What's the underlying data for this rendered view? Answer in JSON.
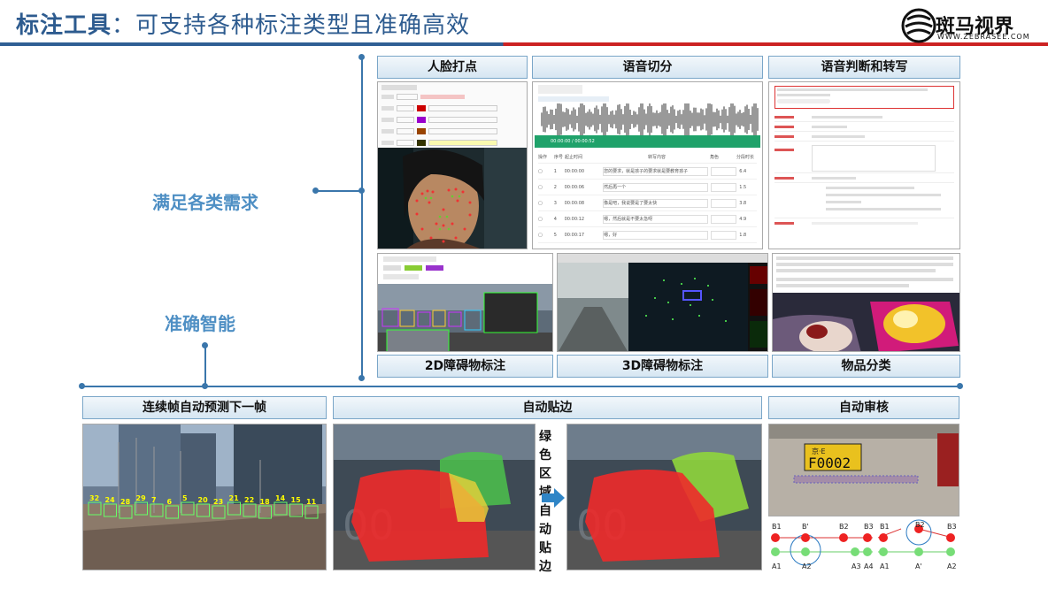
{
  "header": {
    "title_main": "标注工具",
    "title_rest": "：可支持各种标注类型且准确高效"
  },
  "logo": {
    "name": "斑马视界",
    "url_text": "WWW.ZEBRASEE.COM"
  },
  "side_labels": {
    "needs": "满足各类需求",
    "smart": "准确智能"
  },
  "top_panels": {
    "face": "人脸打点",
    "speech_split": "语音切分",
    "speech_judge": "语音判断和转写",
    "obstacle_2d": "2D障碍物标注",
    "obstacle_3d": "3D障碍物标注",
    "item_class": "物品分类"
  },
  "bottom_panels": {
    "predict": "连续帧自动预测下一帧",
    "snap": "自动贴边",
    "review": "自动审核"
  },
  "snap_note": "绿色区域自动贴边",
  "speech_table": {
    "headers": [
      "操作",
      "序号",
      "起止时间",
      "转写内容",
      "角色",
      "分段时长"
    ],
    "rows": [
      {
        "idx": "1",
        "time": "00:00:00\n00:00:06",
        "text": "您的要求，就是孩子的要求就是要教育孩子",
        "dur": "6.4"
      },
      {
        "idx": "2",
        "time": "00:00:06\n00:00:08",
        "text": "然后再一个",
        "dur": "1.5"
      },
      {
        "idx": "3",
        "time": "00:00:08\n00:00:12",
        "text": "像是吧，我说要是了要太快",
        "dur": "3.8"
      },
      {
        "idx": "4",
        "time": "00:00:12\n00:00:17",
        "text": "嗯，然后就是不要太急呀",
        "dur": "4.9"
      },
      {
        "idx": "5",
        "time": "00:00:17\n00:00:18",
        "text": "嗯，好",
        "dur": "1.8"
      }
    ],
    "player_time": "00:00:00 / 00:00:52"
  },
  "review": {
    "plate": "F0002",
    "plate_prefix": "京·E",
    "labels_top": [
      "B1",
      "B'",
      "B2",
      "B3",
      "B1",
      "B2",
      "B3"
    ],
    "labels_bottom": [
      "A1",
      "A2",
      "A3",
      "A4",
      "A1",
      "A'",
      "A2"
    ]
  },
  "predict_ids": [
    "32",
    "24",
    "28",
    "29",
    "7",
    "6",
    "5",
    "20",
    "23",
    "21",
    "22",
    "18",
    "14",
    "15",
    "11"
  ],
  "colors": {
    "title": "#2d5b8f",
    "side_label": "#4e8fc4",
    "accent_red": "#cc2222",
    "line": "#3a76ab"
  }
}
